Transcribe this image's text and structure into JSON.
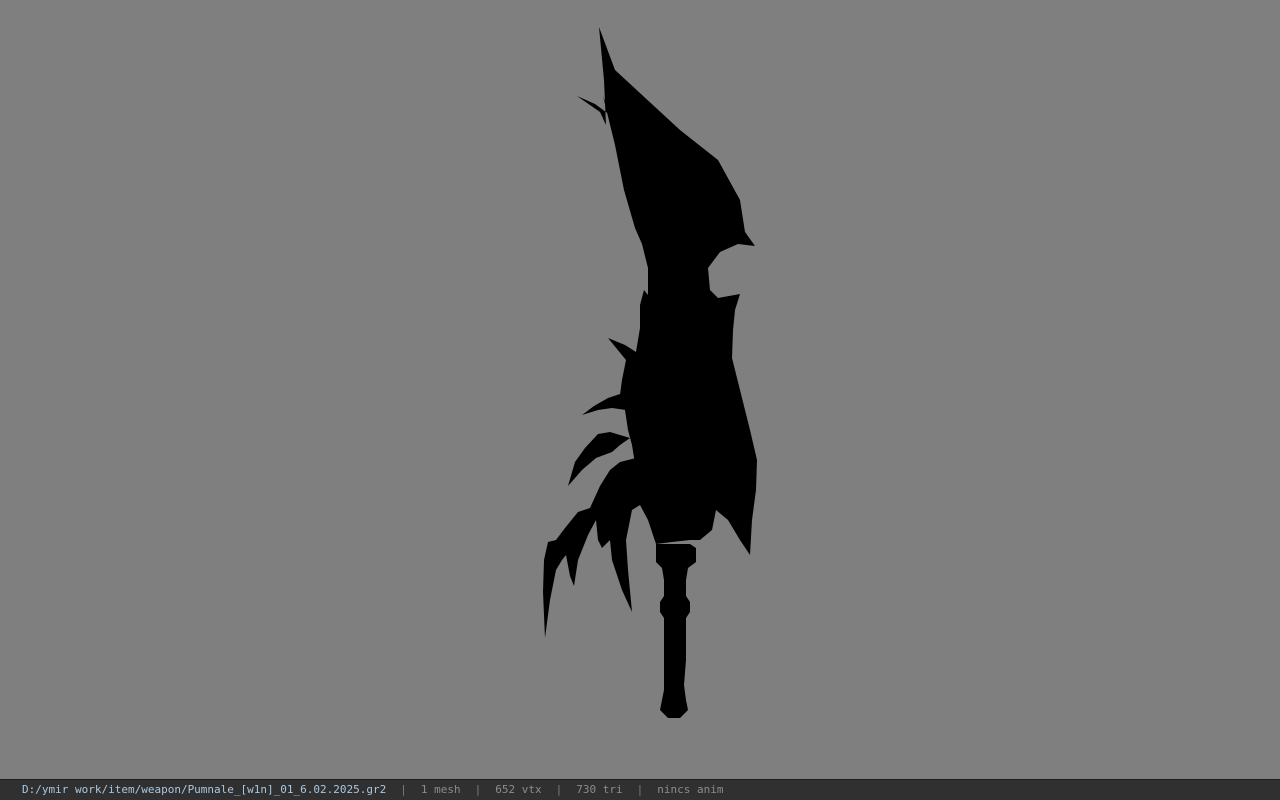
{
  "viewport": {
    "background": "#7f7f7f",
    "model_color": "#000000",
    "model_name": "weapon-silhouette"
  },
  "status_bar": {
    "file_path": "D:/ymir work/item/weapon/Pumnale_[w1n]_01_6.02.2025.gr2",
    "separator": "|",
    "mesh_count": "1 mesh",
    "vertex_count": "652 vtx",
    "triangle_count": "730 tri",
    "animation": "nincs anim"
  }
}
